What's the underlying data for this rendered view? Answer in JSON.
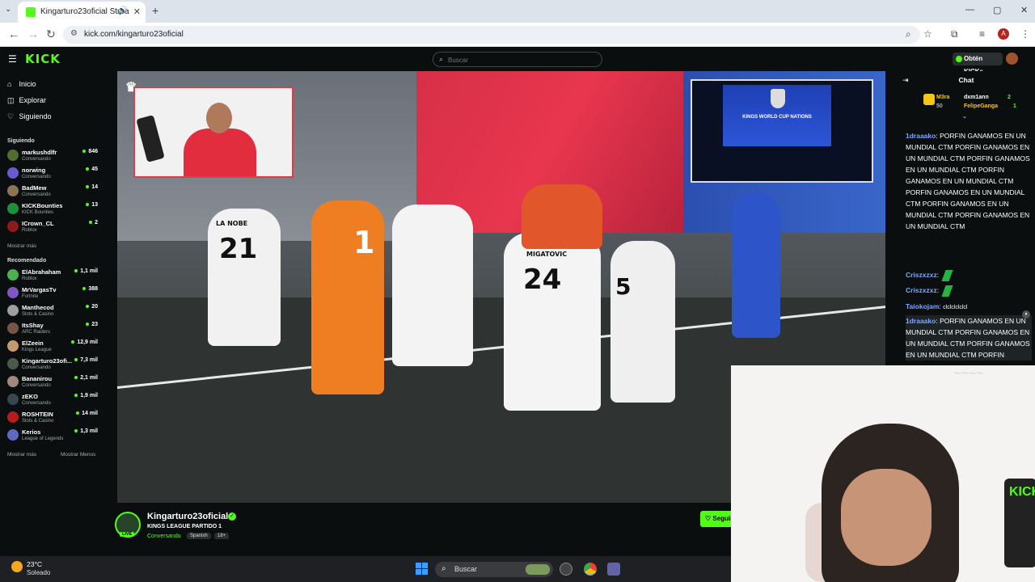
{
  "browser": {
    "tab_title": "Kingarturo23oficial Stream",
    "url": "kick.com/kingarturo23oficial",
    "new_tab": "+",
    "profile_initial": "A"
  },
  "header": {
    "logo": "KICK",
    "search_placeholder": "Buscar",
    "kicks_button": "Obtén KICKs"
  },
  "sidebar": {
    "nav": [
      {
        "label": "Inicio",
        "icon": "home-icon"
      },
      {
        "label": "Explorar",
        "icon": "compass-icon"
      },
      {
        "label": "Siguiendo",
        "icon": "heart-icon"
      }
    ],
    "following_title": "Siguiendo",
    "following": [
      {
        "name": "markushdlfr",
        "category": "Conversando",
        "viewers": "846",
        "color": "#556b2f"
      },
      {
        "name": "norwing",
        "category": "Conversando",
        "viewers": "45",
        "color": "#6a5acd"
      },
      {
        "name": "BadMew",
        "category": "Conversando",
        "viewers": "14",
        "color": "#8b7355"
      },
      {
        "name": "KICKBounties",
        "category": "KICK Bounties",
        "viewers": "13",
        "color": "#1f8f3a"
      },
      {
        "name": "ICrown_CL",
        "category": "Roblox",
        "viewers": "2",
        "color": "#8b1a1a"
      }
    ],
    "show_more": "Mostrar más",
    "recommended_title": "Recomendado",
    "recommended": [
      {
        "name": "ElAbrahaham",
        "category": "Roblox",
        "viewers": "1,1 mil",
        "color": "#4caf50"
      },
      {
        "name": "MrVargasTv",
        "category": "Fortnite",
        "viewers": "388",
        "color": "#7e57c2"
      },
      {
        "name": "Manthecod",
        "category": "Slots & Casino",
        "viewers": "20",
        "color": "#9e9e9e"
      },
      {
        "name": "ItsShay",
        "category": "ARC Raiders",
        "viewers": "23",
        "color": "#795548"
      },
      {
        "name": "ElZeein",
        "category": "Kings League",
        "viewers": "12,9 mil",
        "color": "#c49a6c"
      },
      {
        "name": "Kingarturo23ofi...",
        "category": "Conversando",
        "viewers": "7,3 mil",
        "color": "#4a5a4a"
      },
      {
        "name": "Bananirou",
        "category": "Conversando",
        "viewers": "2,1 mil",
        "color": "#a1887f"
      },
      {
        "name": "zEKO",
        "category": "Conversando",
        "viewers": "1,9 mil",
        "color": "#37474f"
      },
      {
        "name": "ROSHTEIN",
        "category": "Slots & Casino",
        "viewers": "14 mil",
        "color": "#b71c1c"
      },
      {
        "name": "Kerios",
        "category": "League of Legends",
        "viewers": "1,3 mil",
        "color": "#5c6bc0"
      }
    ],
    "show_more2": "Mostrar más",
    "show_less": "Mostrar Menos"
  },
  "video": {
    "jerseys": [
      {
        "name": "LA NOBE",
        "number": "21"
      },
      {
        "name": "",
        "number": "1"
      },
      {
        "name": "MIGATOVIC",
        "number": "24"
      },
      {
        "name": "",
        "number": "5"
      }
    ],
    "pip_text": "KINGS WORLD CUP NATIONS"
  },
  "stream": {
    "channel": "Kingarturo23oficial",
    "title": "KINGS LEAGUE PARTIDO 1",
    "category": "Conversando",
    "tags": [
      "Spanish",
      "18+"
    ],
    "live_badge": "LIVE",
    "follow_label": "Seguir"
  },
  "chat": {
    "title": "Chat",
    "gifters": [
      {
        "name": "M3ra",
        "count": "50"
      },
      {
        "name": "dxm1ann",
        "count": "2"
      },
      {
        "name": "FelipeGanga",
        "count": "1"
      }
    ],
    "messages": [
      {
        "user": "1draaako",
        "color": "#7aa7ff",
        "text": "PORFIN GANAMOS EN UN MUNDIAL CTM PORFIN GANAMOS EN UN MUNDIAL CTM PORFIN GANAMOS EN UN MUNDIAL CTM PORFIN GANAMOS EN UN MUNDIAL CTM PORFIN GANAMOS EN UN MUNDIAL CTM PORFIN GANAMOS EN UN MUNDIAL CTM PORFIN GANAMOS EN UN MUNDIAL CTM"
      },
      {
        "user": "Criszxzxz",
        "color": "#7aa7ff",
        "text": ""
      },
      {
        "user": "Criszxzxz",
        "color": "#7aa7ff",
        "text": ""
      },
      {
        "user": "Taiokojam",
        "color": "#7aa7ff",
        "text": "clclclclclcl"
      },
      {
        "user": "1draaako",
        "color": "#7aa7ff",
        "text": "PORFIN GANAMOS EN UN MUNDIAL CTM PORFIN GANAMOS EN UN MUNDIAL CTM PORFIN GANAMOS EN UN MUNDIAL CTM PORFIN"
      }
    ]
  },
  "taskbar": {
    "temperature": "23°C",
    "condition": "Soleado",
    "search_label": "Buscar"
  },
  "colors": {
    "kick_green": "#53fc18",
    "background": "#0b0e0f"
  }
}
